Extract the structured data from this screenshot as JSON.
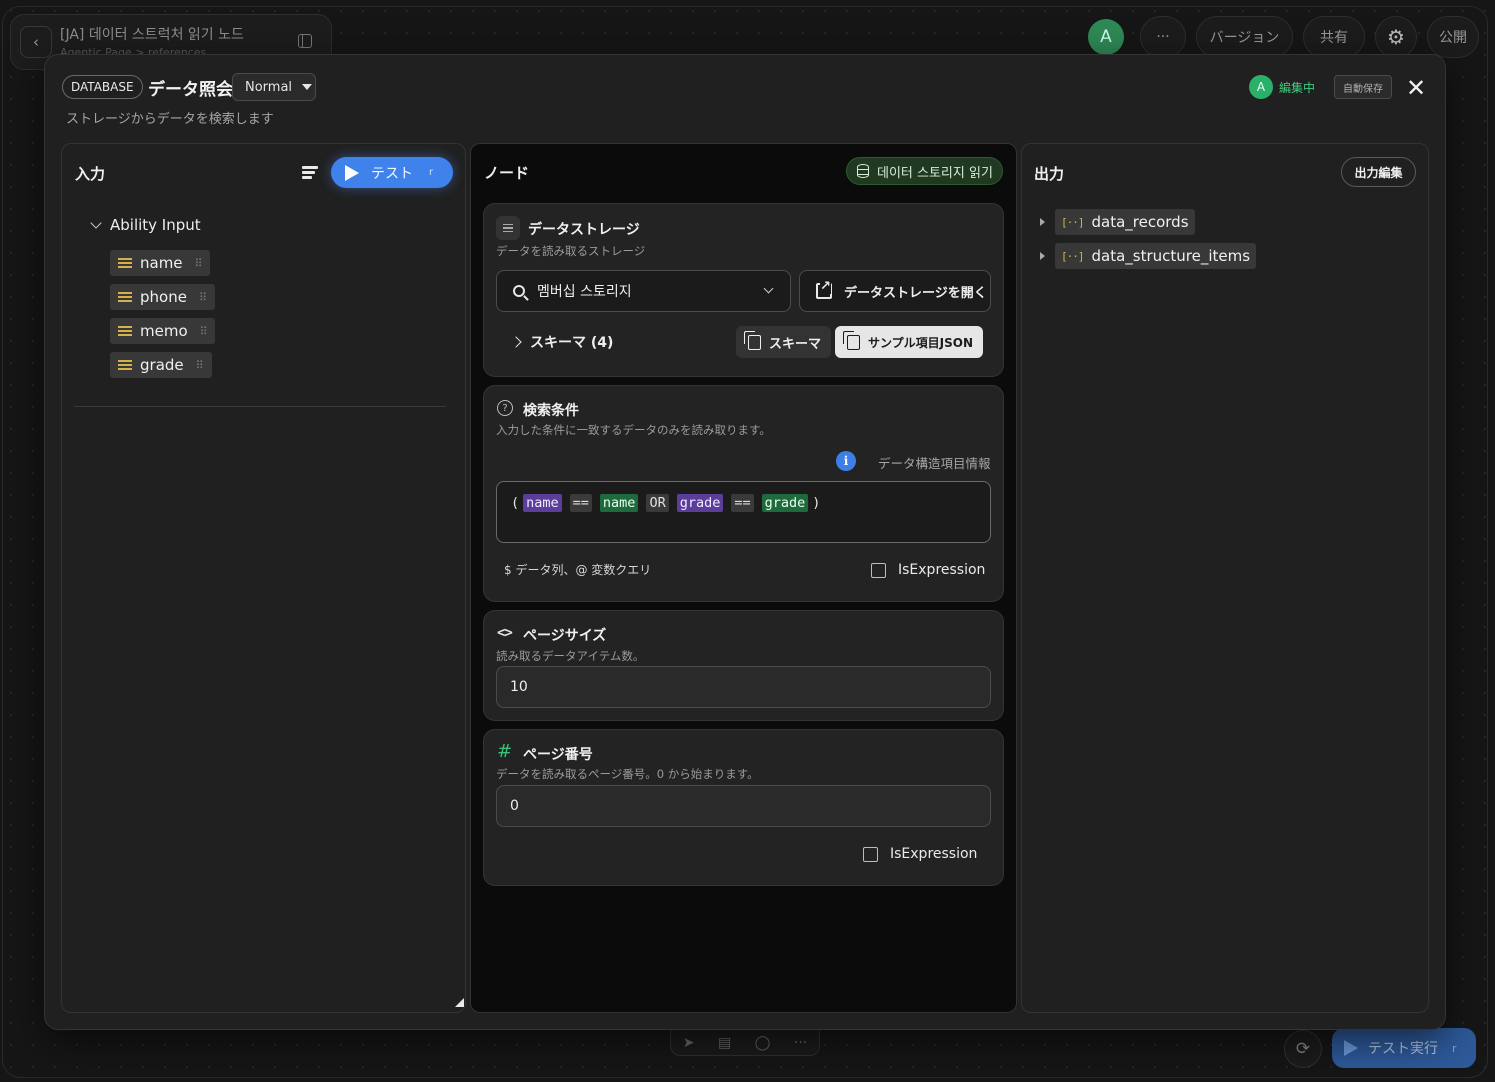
{
  "background": {
    "title": "[JA] 데이터 스트럭처 읽기 노드",
    "subtitle": "Agentic Page > references",
    "avatar_initial": "A",
    "more_label": "···",
    "version_label": "バージョン",
    "share_label": "共有",
    "publish_label": "公開",
    "run_label": "テスト実行",
    "run_key": "r"
  },
  "modal": {
    "category_badge": "DATABASE",
    "title": "データ照会",
    "mode": "Normal",
    "description": "ストレージからデータを検索します",
    "editor_initial": "A",
    "editing_label": "編集中",
    "autosave_label": "自動保存",
    "close_label": "✕"
  },
  "input_panel": {
    "title": "入力",
    "test_label": "テスト",
    "test_key": "r",
    "group_label": "Ability Input",
    "fields": [
      "name",
      "phone",
      "memo",
      "grade"
    ]
  },
  "node_panel": {
    "title": "ノード",
    "badge": "데이터 스토리지 읽기",
    "storage": {
      "title": "データストレージ",
      "description": "データを読み取るストレージ",
      "selected": "멤버십 스토리지",
      "open_label": "データストレージを開く",
      "schema_label": "スキーマ (4)",
      "schema_btn": "スキーマ",
      "sample_btn": "サンプル項目JSON"
    },
    "search": {
      "title": "検索条件",
      "description": "入力した条件に一致するデータのみを読み取ります。",
      "info_label": "データ構造項目情報",
      "expression": {
        "open": "(",
        "tokens": [
          {
            "text": "name",
            "kind": "var"
          },
          {
            "text": "==",
            "kind": "op"
          },
          {
            "text": "name",
            "kind": "col"
          },
          {
            "text": "OR",
            "kind": "op"
          },
          {
            "text": "grade",
            "kind": "var"
          },
          {
            "text": "==",
            "kind": "op"
          },
          {
            "text": "grade",
            "kind": "col"
          }
        ],
        "close": ")"
      },
      "hint": "$ データ列、@ 変数クエリ",
      "is_expression_label": "IsExpression"
    },
    "page_size": {
      "title": "ページサイズ",
      "description": "読み取るデータアイテム数。",
      "value": "10"
    },
    "page_number": {
      "title": "ページ番号",
      "description": "データを読み取るページ番号。0 から始まります。",
      "value": "0",
      "is_expression_label": "IsExpression"
    }
  },
  "output_panel": {
    "title": "出力",
    "edit_label": "出力編集",
    "items": [
      "data_records",
      "data_structure_items"
    ]
  },
  "colors": {
    "accent_blue": "#3f82ec",
    "editing_green": "#3ecf7f",
    "token_var": "#5b3e9a",
    "token_col": "#1f6a3c"
  }
}
